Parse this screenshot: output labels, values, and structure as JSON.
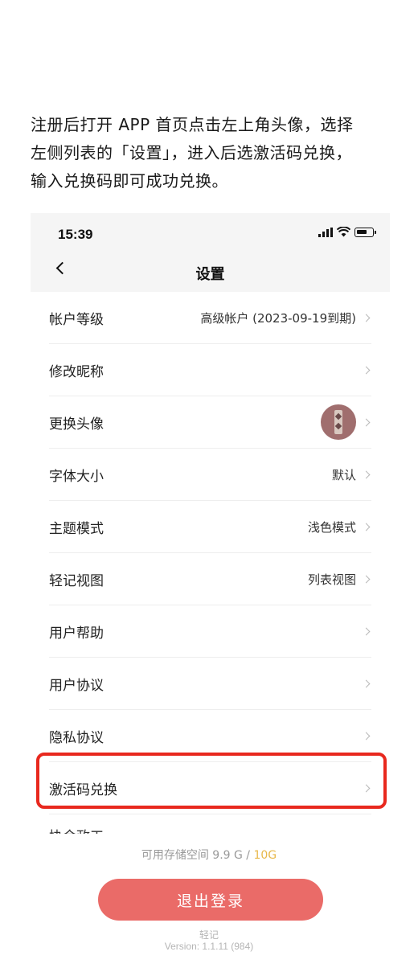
{
  "instructions": {
    "line1": "注册后打开 APP 首页点击左上角头像，选择",
    "line2": "左侧列表的「设置」，进入后选激活码兑换，",
    "line3": "输入兑换码即可成功兑换。"
  },
  "status_bar": {
    "time": "15:39"
  },
  "nav": {
    "title": "设置",
    "back_icon": "chevron-left-icon"
  },
  "settings": {
    "rows": [
      {
        "label": "帐户等级",
        "value": "高级帐户 (2023-09-19到期)"
      },
      {
        "label": "修改昵称",
        "value": ""
      },
      {
        "label": "更换头像",
        "value": ""
      },
      {
        "label": "字体大小",
        "value": "默认"
      },
      {
        "label": "主题模式",
        "value": "浅色模式"
      },
      {
        "label": "轻记视图",
        "value": "列表视图"
      },
      {
        "label": "用户帮助",
        "value": ""
      },
      {
        "label": "用户协议",
        "value": ""
      },
      {
        "label": "隐私协议",
        "value": ""
      },
      {
        "label": "激活码兑换",
        "value": ""
      }
    ],
    "partial_row_label": "协会政工"
  },
  "storage": {
    "prefix": "可用存储空间 9.9 G / ",
    "quota": "10G"
  },
  "logout_label": "退出登录",
  "footer": {
    "app_name": "轻记",
    "version": "Version: 1.1.11 (984)"
  },
  "colors": {
    "highlight": "#e8281e",
    "logout_bg": "#ea6b68",
    "quota": "#e8b84a"
  }
}
